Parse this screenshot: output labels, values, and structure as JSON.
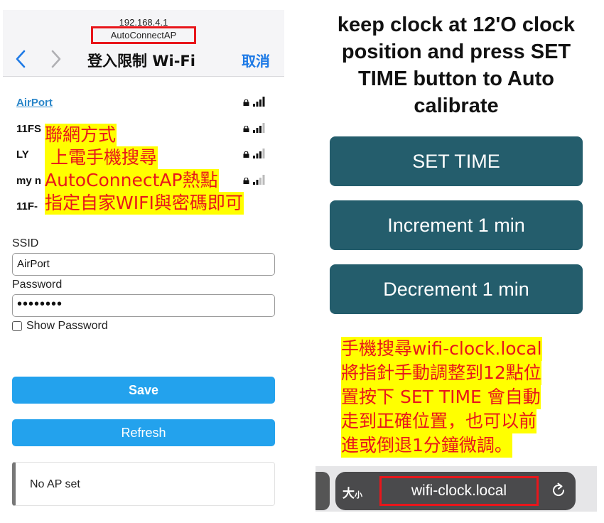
{
  "left_panel": {
    "ip": "192.168.4.1",
    "ap_name": "AutoConnectAP",
    "nav_title": "登入限制 Wi-Fi",
    "cancel_label": "取消",
    "networks": [
      {
        "name": "AirPort"
      },
      {
        "name": "11FS"
      },
      {
        "name": "LY"
      },
      {
        "name": "my n"
      },
      {
        "name": "11F-"
      }
    ],
    "overlay_lines": [
      "聯網方式",
      " 上電手機搜尋",
      "AutoConnectAP熱點",
      "指定自家WIFI與密碼即可"
    ],
    "ssid_label": "SSID",
    "ssid_value": "AirPort",
    "password_label": "Password",
    "password_value": "••••••••",
    "show_password_label": "Show Password",
    "save_label": "Save",
    "refresh_label": "Refresh",
    "status_text": "No AP set"
  },
  "right_panel": {
    "heading_lines": [
      "keep clock at 12'O clock",
      "position and press SET",
      "TIME button to Auto",
      "calibrate"
    ],
    "buttons": {
      "set_time": "SET TIME",
      "increment": "Increment 1 min",
      "decrement": "Decrement 1 min"
    },
    "note_lines": [
      "手機搜尋wifi-clock.local",
      "將指針手動調整到12點位",
      "置按下 SET TIME 會自動",
      "走到正確位置，也可以前",
      "進或倒退1分鐘微調。"
    ],
    "text_size_big": "大",
    "text_size_small": "小",
    "url": "wifi-clock.local"
  },
  "colors": {
    "accent_blue": "#23a2ed",
    "dark_teal": "#245d6c",
    "highlight_red": "#e8161b",
    "highlight_yellow": "#ffff00",
    "ios_blue": "#1e7ae6"
  },
  "icons": [
    "chevron-left-icon",
    "chevron-right-icon",
    "lock-icon",
    "wifi-signal-icon",
    "reload-icon"
  ]
}
